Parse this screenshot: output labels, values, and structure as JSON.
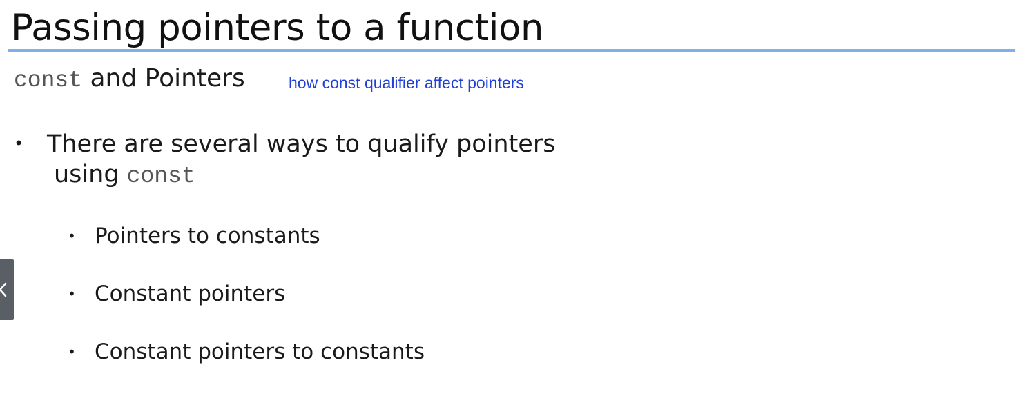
{
  "slide": {
    "title": "Passing pointers to a function",
    "subtitle_code": "const",
    "subtitle_text": " and Pointers",
    "annotation": "how const qualifier affect pointers",
    "main_bullet": {
      "line1": "There are several ways to qualify pointers",
      "line2_text": "using ",
      "line2_code": "const"
    },
    "sub_bullets": [
      "Pointers to constants",
      "Constant pointers",
      "Constant pointers to constants"
    ]
  },
  "side_tab": {
    "icon": "chevron-left-icon"
  },
  "colors": {
    "title_rule": "#7fb0ec",
    "annotation": "#1f3fd8",
    "side_tab": "#5a5f66"
  }
}
